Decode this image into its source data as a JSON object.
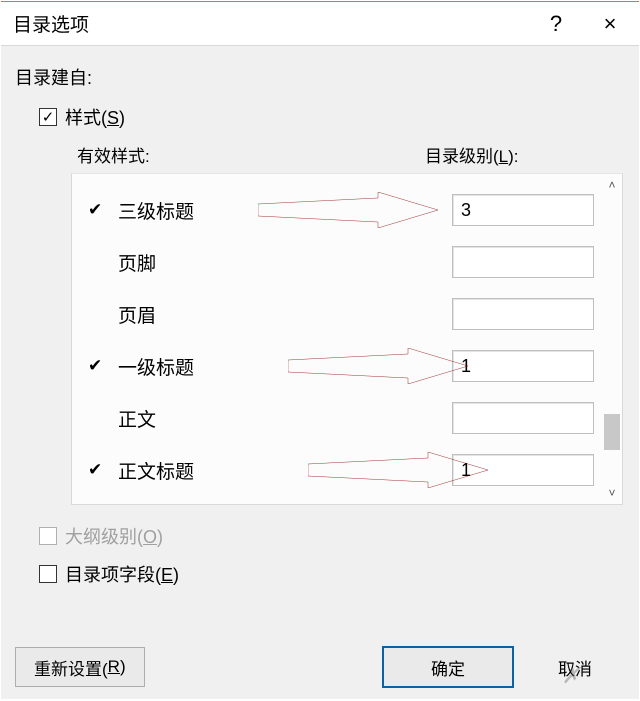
{
  "dialog": {
    "title": "目录选项",
    "help": "?",
    "close": "×"
  },
  "section_label": "目录建自:",
  "styles_checkbox": {
    "label": "样式(",
    "mnemonic": "S",
    "suffix": ")",
    "checked": true
  },
  "columns": {
    "left": "有效样式:",
    "right": "目录级别(",
    "right_mnemonic": "L",
    "right_suffix": "):"
  },
  "styles": [
    {
      "checked": true,
      "name": "三级标题",
      "level": "3",
      "arrow": true
    },
    {
      "checked": false,
      "name": "页脚",
      "level": "",
      "arrow": false
    },
    {
      "checked": false,
      "name": "页眉",
      "level": "",
      "arrow": false
    },
    {
      "checked": true,
      "name": "一级标题",
      "level": "1",
      "arrow": true
    },
    {
      "checked": false,
      "name": "正文",
      "level": "",
      "arrow": false
    },
    {
      "checked": true,
      "name": "正文标题",
      "level": "1",
      "arrow": true
    }
  ],
  "outline_checkbox": {
    "label": "大纲级别(",
    "mnemonic": "O",
    "suffix": ")"
  },
  "entry_checkbox": {
    "label": "目录项字段(",
    "mnemonic": "E",
    "suffix": ")"
  },
  "buttons": {
    "reset": {
      "label": "重新设置(",
      "mnemonic": "R",
      "suffix": ")"
    },
    "ok": "确定",
    "cancel": "取消"
  },
  "scroll": {
    "up": "˄",
    "down": "˅"
  }
}
